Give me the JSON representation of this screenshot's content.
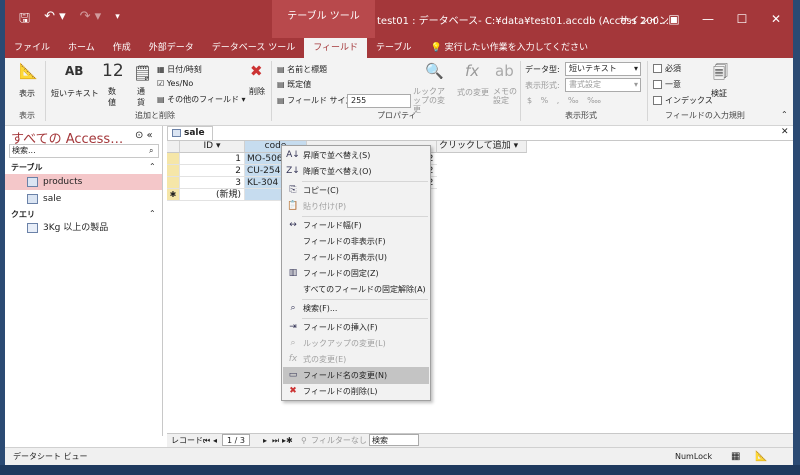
{
  "titlebar": {
    "context_tab": "テーブル ツール",
    "doc_title": "test01 : データベース- C:¥data¥test01.accdb (Access 200…",
    "signin": "サインイン",
    "qat_icons": [
      "save-icon",
      "undo-icon",
      "redo-icon",
      "customize-icon"
    ]
  },
  "ribbon_tabs": [
    "ファイル",
    "ホーム",
    "作成",
    "外部データ",
    "データベース ツール",
    "フィールド",
    "テーブル"
  ],
  "active_tab": "フィールド",
  "tell_me": "実行したい作業を入力してください",
  "ribbon": {
    "view_label": "表示",
    "short_text": "短いテキスト",
    "number": "数値",
    "currency": "通貨",
    "datetime": "日付/時刻",
    "yesno": "Yes/No",
    "more_fields": "その他のフィールド",
    "delete": "削除",
    "group_view": "表示",
    "group_add_delete": "追加と削除",
    "name_caption": "名前と標題",
    "default_value": "既定値",
    "field_size_label": "フィールド サイズ",
    "field_size_value": "255",
    "lookup_change": "ルックアップの変更",
    "formula_change": "式の変更",
    "memo_settings": "メモの設定",
    "group_properties": "プロパティ",
    "data_type_label": "データ型:",
    "data_type_value": "短いテキスト",
    "format_label": "表示形式:",
    "format_value": "書式設定",
    "group_format": "表示形式",
    "required": "必須",
    "unique": "一意",
    "indexed": "インデックス",
    "validation": "検証",
    "group_validation": "フィールドの入力規則"
  },
  "nav": {
    "title": "すべての Access…",
    "search_placeholder": "検索...",
    "section_tables": "テーブル",
    "tables": [
      "products",
      "sale"
    ],
    "section_queries": "クエリ",
    "queries": [
      "3Kg 以上の製品"
    ]
  },
  "document": {
    "tab": "sale",
    "headers": [
      "ID",
      "code",
      "",
      "",
      "クリックして追加"
    ],
    "rows": [
      {
        "id": "1",
        "code": "MO-506",
        "tail": "02"
      },
      {
        "id": "2",
        "code": "CU-254",
        "tail": "02"
      },
      {
        "id": "3",
        "code": "KL-304",
        "tail": "02"
      }
    ],
    "new_row": "(新規)"
  },
  "record_nav": {
    "label": "レコード:",
    "position": "1 / 3",
    "filter": "フィルターなし",
    "search": "検索"
  },
  "status": {
    "view": "データシート ビュー",
    "numlock": "NumLock"
  },
  "context_menu": {
    "sort_asc": "昇順で並べ替え(S)",
    "sort_desc": "降順で並べ替え(O)",
    "copy": "コピー(C)",
    "paste": "貼り付け(P)",
    "field_width": "フィールド幅(F)",
    "hide_fields": "フィールドの非表示(F)",
    "unhide_fields": "フィールドの再表示(U)",
    "freeze": "フィールドの固定(Z)",
    "unfreeze_all": "すべてのフィールドの固定解除(A)",
    "find": "検索(F)...",
    "insert_field": "フィールドの挿入(F)",
    "lookup_change": "ルックアップの変更(L)",
    "formula_change": "式の変更(E)",
    "rename_field": "フィールド名の変更(N)",
    "delete_field": "フィールドの削除(L)"
  }
}
